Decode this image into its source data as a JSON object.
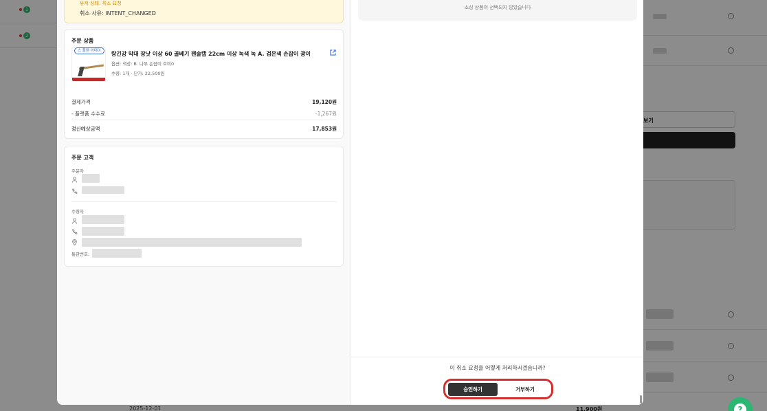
{
  "background": {
    "badges": [
      "1",
      "2"
    ],
    "right_button_label": "보기",
    "bottom_row": {
      "date": "2025-12-01",
      "price": "11,900원"
    }
  },
  "modal": {
    "status_line": "유저 상태: 취소 요청",
    "cancel_reason": "취소 사유: INTENT_CHANGED",
    "order_product": {
      "title": "주문 상품",
      "partner_badge": "스 플랜 어데이",
      "name": "랑긴강 막대 장낫 이상 60 골베기 팬솔캡 22cm 이상 녹색 녹 A. 검은색 손잡이 광이",
      "option": "옵션: 색상: B. 나무 손잡이 호미0",
      "qty_price": "수량: 1개  ·  단가: 22,500원",
      "rows": [
        {
          "label": "결제가격",
          "value": "19,120원"
        },
        {
          "label": "- 플랫폼 수수료",
          "value": "-1,267원"
        },
        {
          "label": "정산예상금액",
          "value": "17,853원"
        }
      ]
    },
    "customer": {
      "title": "주문 고객",
      "orderer_label": "주문자",
      "recipient_label": "수령자",
      "customs_label": "통관번호:"
    },
    "right_note": "소싱 상품이 선택되지 않았습니다",
    "footer": {
      "question": "이 취소 요청을 어떻게 처리하시겠습니까?",
      "approve_label": "승인하기",
      "reject_label": "거부하기"
    }
  },
  "colors": {
    "accent_red": "#d32f2f",
    "status_yellow": "#fff8dc",
    "help_green": "#2bb673"
  },
  "icons": [
    "person-icon",
    "phone-icon",
    "location-icon",
    "external-link-icon",
    "search-icon",
    "help-icon"
  ]
}
